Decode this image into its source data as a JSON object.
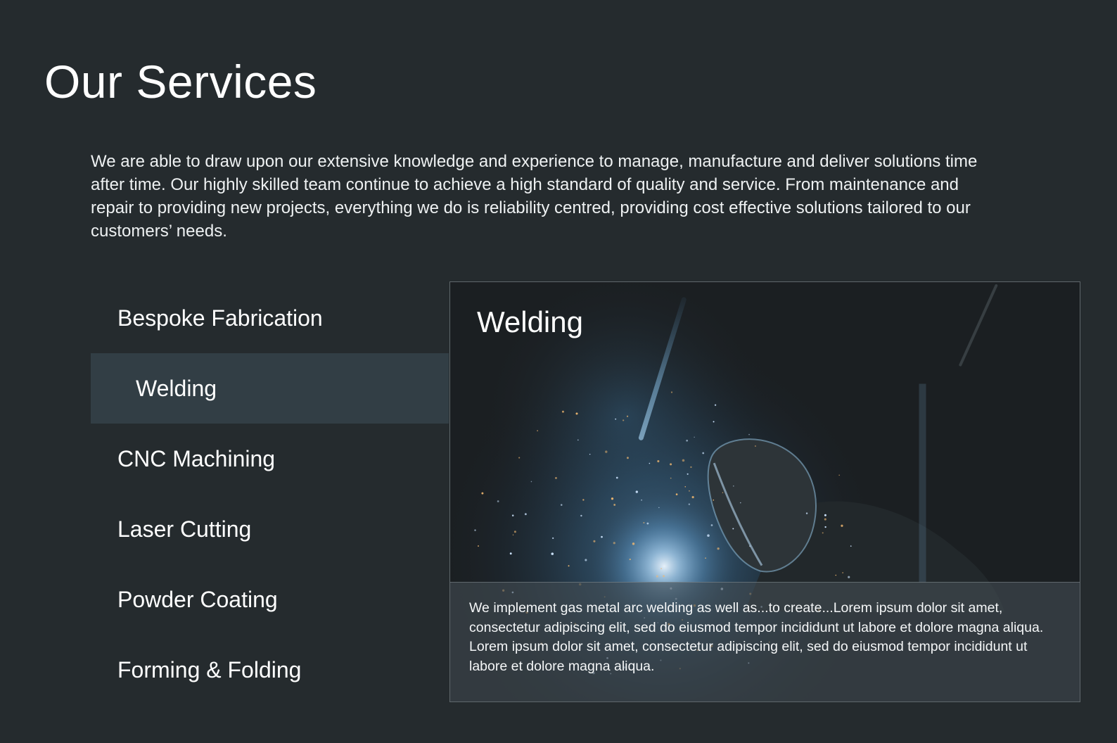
{
  "header": {
    "title": "Our Services"
  },
  "intro": {
    "text": "We are able to draw upon our extensive knowledge and experience to manage, manufacture and deliver solutions time after time. Our highly skilled team continue to achieve a high standard of quality and service. From maintenance and repair to providing new projects, everything we do is reliability centred, providing cost effective solutions tailored to our customers’ needs."
  },
  "services": {
    "items": [
      {
        "label": "Bespoke Fabrication",
        "active": false
      },
      {
        "label": "Welding",
        "active": true
      },
      {
        "label": "CNC Machining",
        "active": false
      },
      {
        "label": "Laser Cutting",
        "active": false
      },
      {
        "label": "Powder Coating",
        "active": false
      },
      {
        "label": "Forming & Folding",
        "active": false
      }
    ]
  },
  "detail": {
    "title": "Welding",
    "description": "We implement gas metal arc welding as well as...to create...Lorem ipsum dolor sit amet, consectetur adipiscing elit, sed do eiusmod tempor incididunt ut labore et dolore magna aliqua. Lorem ipsum dolor sit amet, consectetur adipiscing elit, sed do eiusmod tempor incididunt ut labore et dolore magna aliqua."
  },
  "colors": {
    "background": "#252b2e",
    "active_item": "#323e45",
    "text": "#ffffff",
    "panel_border": "#5f676b"
  }
}
